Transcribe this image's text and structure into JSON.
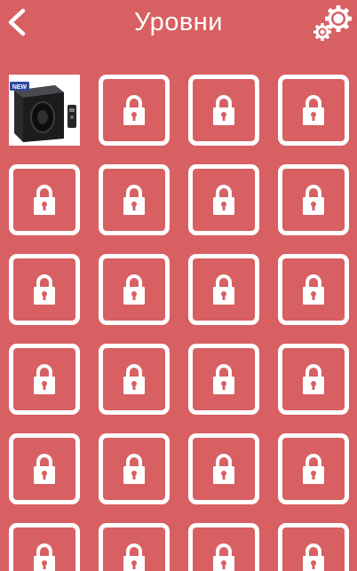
{
  "header": {
    "title": "Уровни",
    "back_icon": "chevron-left-icon",
    "settings_icon": "gears-icon"
  },
  "levels": {
    "columns": 4,
    "visible_rows": 6,
    "items": [
      {
        "state": "unlocked",
        "thumbnail": "subwoofer-product-image",
        "badge": "NEW"
      },
      {
        "state": "locked"
      },
      {
        "state": "locked"
      },
      {
        "state": "locked"
      },
      {
        "state": "locked"
      },
      {
        "state": "locked"
      },
      {
        "state": "locked"
      },
      {
        "state": "locked"
      },
      {
        "state": "locked"
      },
      {
        "state": "locked"
      },
      {
        "state": "locked"
      },
      {
        "state": "locked"
      },
      {
        "state": "locked"
      },
      {
        "state": "locked"
      },
      {
        "state": "locked"
      },
      {
        "state": "locked"
      },
      {
        "state": "locked"
      },
      {
        "state": "locked"
      },
      {
        "state": "locked"
      },
      {
        "state": "locked"
      },
      {
        "state": "locked"
      },
      {
        "state": "locked"
      },
      {
        "state": "locked"
      },
      {
        "state": "locked"
      }
    ]
  },
  "colors": {
    "background": "#d85f62",
    "foreground": "#ffffff",
    "badge": "#2c4a9e"
  }
}
